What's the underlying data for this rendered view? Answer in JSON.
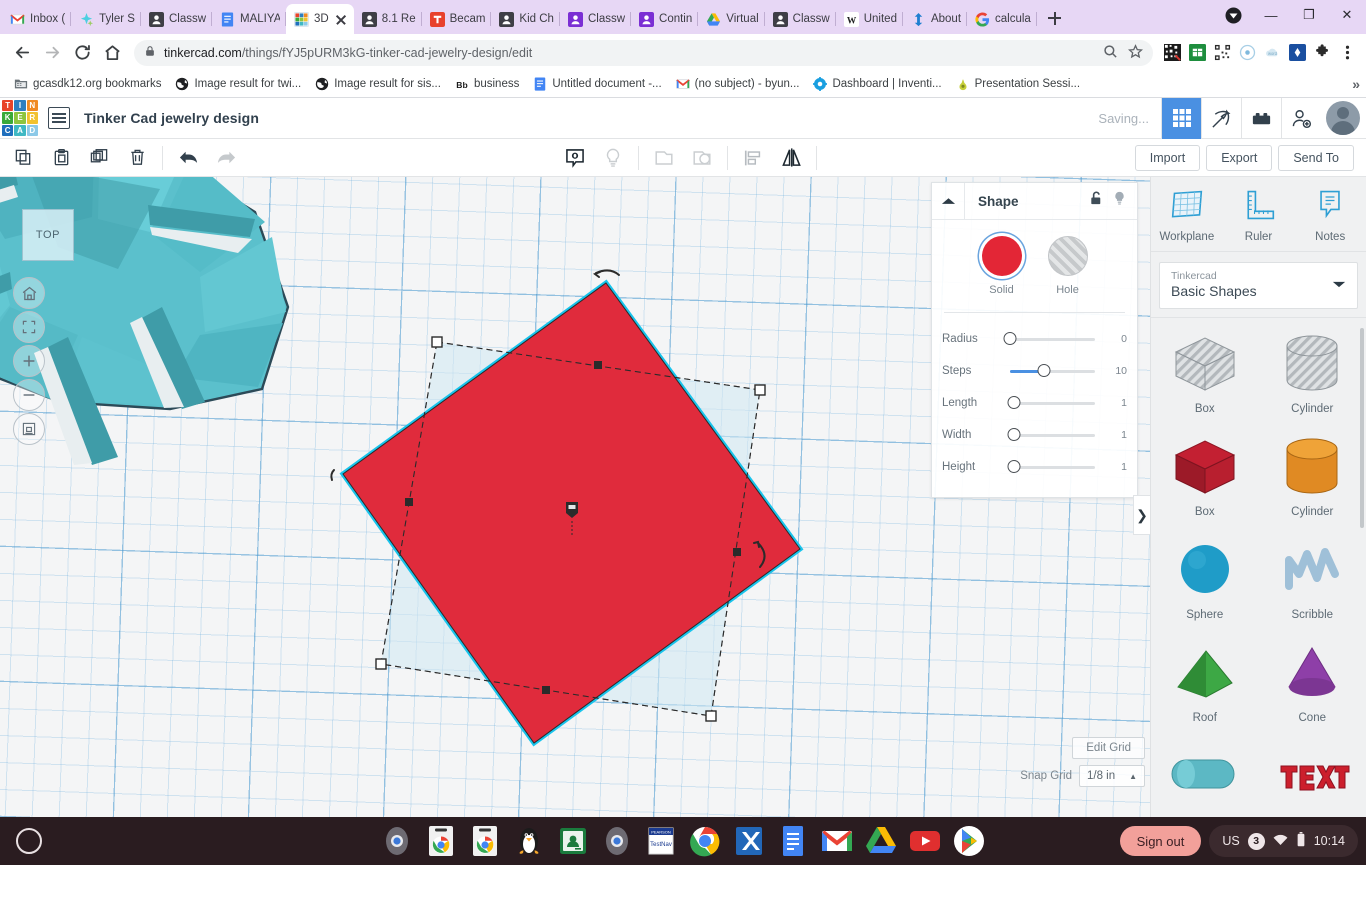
{
  "browser": {
    "tabs": [
      {
        "label": "Inbox (",
        "icon": "gmail-icon",
        "active": false
      },
      {
        "label": "Tyler S",
        "icon": "sparkle-icon",
        "active": false
      },
      {
        "label": "Classw",
        "icon": "classroom-icon",
        "active": false
      },
      {
        "label": "MALIYA",
        "icon": "docs-icon",
        "active": false
      },
      {
        "label": "3D",
        "icon": "tinkercad-icon",
        "active": true
      },
      {
        "label": "8.1 Re",
        "icon": "classroom-icon",
        "active": false
      },
      {
        "label": "Becam",
        "icon": "red-t-icon",
        "active": false
      },
      {
        "label": "Kid Ch",
        "icon": "classroom-icon",
        "active": false
      },
      {
        "label": "Classw",
        "icon": "purple-classroom-icon",
        "active": false
      },
      {
        "label": "Contin",
        "icon": "purple-classroom-icon",
        "active": false
      },
      {
        "label": "Virtual",
        "icon": "drive-icon",
        "active": false
      },
      {
        "label": "Classw",
        "icon": "classroom-icon",
        "active": false
      },
      {
        "label": "United",
        "icon": "wikipedia-icon",
        "active": false
      },
      {
        "label": "About",
        "icon": "blue-anchor-icon",
        "active": false
      },
      {
        "label": "calcula",
        "icon": "google-icon",
        "active": false
      }
    ],
    "url_host": "tinkercad.com",
    "url_path": "/things/fYJ5pURM3kG-tinker-cad-jewelry-design/edit",
    "window_controls": {
      "minimize": "—",
      "maximize": "❐",
      "close": "✕"
    },
    "bookmarks": [
      {
        "label": "gcasdk12.org bookmarks",
        "icon": "folder-icon"
      },
      {
        "label": "Image result for twi...",
        "icon": "globe-icon"
      },
      {
        "label": "Image result for sis...",
        "icon": "globe-icon"
      },
      {
        "label": "business",
        "icon": "blackboard-icon"
      },
      {
        "label": "Untitled document -...",
        "icon": "docs-icon"
      },
      {
        "label": "(no subject) - byun...",
        "icon": "gmail-icon"
      },
      {
        "label": "Dashboard | Inventi...",
        "icon": "gear-icon"
      },
      {
        "label": "Presentation Sessi...",
        "icon": "pear-icon"
      }
    ],
    "bookmark_overflow": "»"
  },
  "tinkercad": {
    "title": "Tinker Cad jewelry design",
    "logo_tiles": [
      {
        "letter": "T",
        "color": "#e8442a"
      },
      {
        "letter": "I",
        "color": "#2e7fc1"
      },
      {
        "letter": "N",
        "color": "#f08a24"
      },
      {
        "letter": "K",
        "color": "#3aa93a"
      },
      {
        "letter": "E",
        "color": "#8ec53f"
      },
      {
        "letter": "R",
        "color": "#f2c230"
      },
      {
        "letter": "C",
        "color": "#1f6fbd"
      },
      {
        "letter": "A",
        "color": "#3fb8c4"
      },
      {
        "letter": "D",
        "color": "#8cc9e8"
      }
    ],
    "saving_status": "Saving...",
    "mode_buttons": [
      {
        "name": "3d-design-mode",
        "icon": "grid-icon",
        "active": true
      },
      {
        "name": "codeblocks-mode",
        "icon": "pickaxe-icon",
        "active": false
      },
      {
        "name": "blocks-mode",
        "icon": "brick-icon",
        "active": false
      },
      {
        "name": "invite-people",
        "icon": "add-person-icon",
        "active": false
      }
    ],
    "toolbar": {
      "left_icons": [
        {
          "name": "copy-button",
          "icon": "copy-icon"
        },
        {
          "name": "paste-button",
          "icon": "paste-icon"
        },
        {
          "name": "duplicate-button",
          "icon": "duplicate-icon"
        },
        {
          "name": "delete-button",
          "icon": "trash-icon"
        },
        {
          "name": "undo-button",
          "icon": "undo-arrow-icon"
        },
        {
          "name": "redo-button",
          "icon": "redo-arrow-icon"
        }
      ],
      "center_icons": [
        {
          "name": "notes-button",
          "icon": "note-bubble-icon"
        },
        {
          "name": "light-button",
          "icon": "lightbulb-icon"
        },
        {
          "name": "group-button",
          "icon": "group-icon"
        },
        {
          "name": "ungroup-button",
          "icon": "ungroup-icon"
        },
        {
          "name": "align-button",
          "icon": "align-icon"
        },
        {
          "name": "mirror-button",
          "icon": "mirror-icon"
        }
      ],
      "import_label": "Import",
      "export_label": "Export",
      "sendto_label": "Send To"
    },
    "viewcube_label": "TOP",
    "view_controls": [
      {
        "name": "home-view-button",
        "icon": "home-icon"
      },
      {
        "name": "fit-view-button",
        "icon": "fit-brackets-icon"
      },
      {
        "name": "zoom-in-button",
        "icon": "plus-icon"
      },
      {
        "name": "zoom-out-button",
        "icon": "minus-icon"
      },
      {
        "name": "perspective-toggle",
        "icon": "perspective-icon"
      }
    ],
    "shape_panel": {
      "title": "Shape",
      "lock_icon": "unlock-icon",
      "light_icon": "lightbulb-icon",
      "solid_label": "Solid",
      "hole_label": "Hole",
      "solid_color": "#e32636",
      "sliders": [
        {
          "label": "Radius",
          "value": "0",
          "pct": 0
        },
        {
          "label": "Steps",
          "value": "10",
          "pct": 40
        },
        {
          "label": "Length",
          "value": "1",
          "pct": 5
        },
        {
          "label": "Width",
          "value": "1",
          "pct": 5
        },
        {
          "label": "Height",
          "value": "1",
          "pct": 5
        }
      ]
    },
    "grid_controls": {
      "edit_grid_label": "Edit Grid",
      "snap_grid_label": "Snap Grid",
      "snap_grid_value": "1/8 in"
    },
    "collapse_chevron": "❯",
    "sidebar": {
      "tools": [
        {
          "label": "Workplane",
          "icon": "workplane-icon"
        },
        {
          "label": "Ruler",
          "icon": "ruler-icon"
        },
        {
          "label": "Notes",
          "icon": "notes-icon"
        }
      ],
      "picker_sup": "Tinkercad",
      "picker_main": "Basic Shapes",
      "shapes": [
        {
          "label": "Box",
          "kind": "box-hatch",
          "color": "#b7bcc0"
        },
        {
          "label": "Cylinder",
          "kind": "cylinder-hatch",
          "color": "#b7bcc0"
        },
        {
          "label": "Box",
          "kind": "box",
          "color": "#c32032"
        },
        {
          "label": "Cylinder",
          "kind": "cylinder",
          "color": "#e08a23"
        },
        {
          "label": "Sphere",
          "kind": "sphere",
          "color": "#1f9cc8"
        },
        {
          "label": "Scribble",
          "kind": "scribble",
          "color": "#9fc0d8"
        },
        {
          "label": "Roof",
          "kind": "roof",
          "color": "#3da845"
        },
        {
          "label": "Cone",
          "kind": "cone",
          "color": "#8e3fa8"
        },
        {
          "label": "",
          "kind": "round-cylinder",
          "color": "#5cb8c4"
        },
        {
          "label": "",
          "kind": "text",
          "color": "#cc1f2d"
        }
      ]
    }
  },
  "shelf": {
    "launcher_icon": "launcher-circle-icon",
    "apps": [
      {
        "name": "camera-app",
        "icon": "camera-icon"
      },
      {
        "name": "chrome-shortcut-1",
        "icon": "chrome-card-icon"
      },
      {
        "name": "chrome-shortcut-2",
        "icon": "chrome-card-icon"
      },
      {
        "name": "linux-terminal",
        "icon": "penguin-icon"
      },
      {
        "name": "classroom-app",
        "icon": "classroom-green-icon"
      },
      {
        "name": "camera-app-2",
        "icon": "camera-icon"
      },
      {
        "name": "pearson-testnav",
        "icon": "testnav-icon"
      },
      {
        "name": "chrome-browser",
        "icon": "chrome-icon",
        "open": true
      },
      {
        "name": "xtramath-app",
        "icon": "xtramath-icon"
      },
      {
        "name": "google-docs",
        "icon": "docs-icon"
      },
      {
        "name": "gmail-app",
        "icon": "gmail-icon"
      },
      {
        "name": "google-drive",
        "icon": "drive-icon"
      },
      {
        "name": "youtube-app",
        "icon": "youtube-icon"
      },
      {
        "name": "play-store",
        "icon": "play-icon"
      }
    ],
    "sign_out_label": "Sign out",
    "tray": {
      "locale": "US",
      "notification_count": "3",
      "wifi_icon": "wifi-icon",
      "battery_icon": "battery-icon",
      "time": "10:14"
    }
  }
}
